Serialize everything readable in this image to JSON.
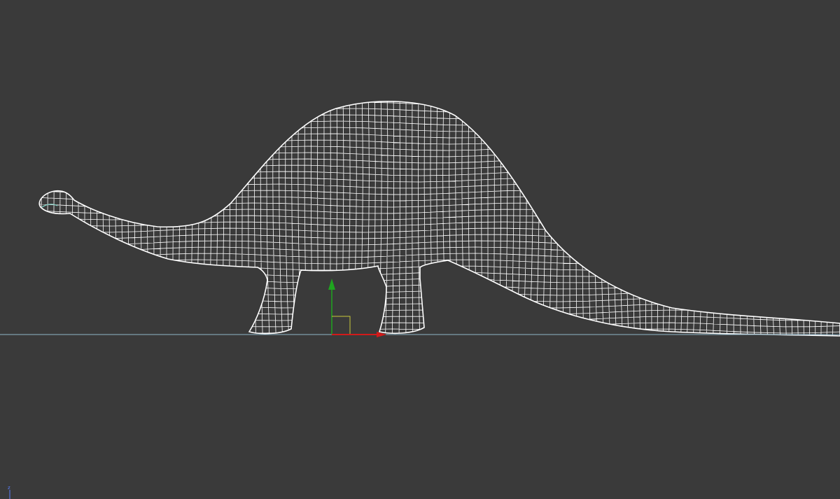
{
  "viewport": {
    "background_color": "#3a3a3a",
    "wireframe_color": "#ffffff",
    "ground_line_color": "#8fb6c8",
    "gizmo": {
      "y_axis_color": "#1fa51f",
      "x_axis_color": "#d11a1a",
      "icon": "transform-gizmo-icon"
    },
    "axis_tripod": {
      "icon": "view-axis-tripod-icon",
      "label": "z",
      "color": "#5a7fff"
    },
    "model_icon": "dinosaur-wireframe-mesh"
  }
}
